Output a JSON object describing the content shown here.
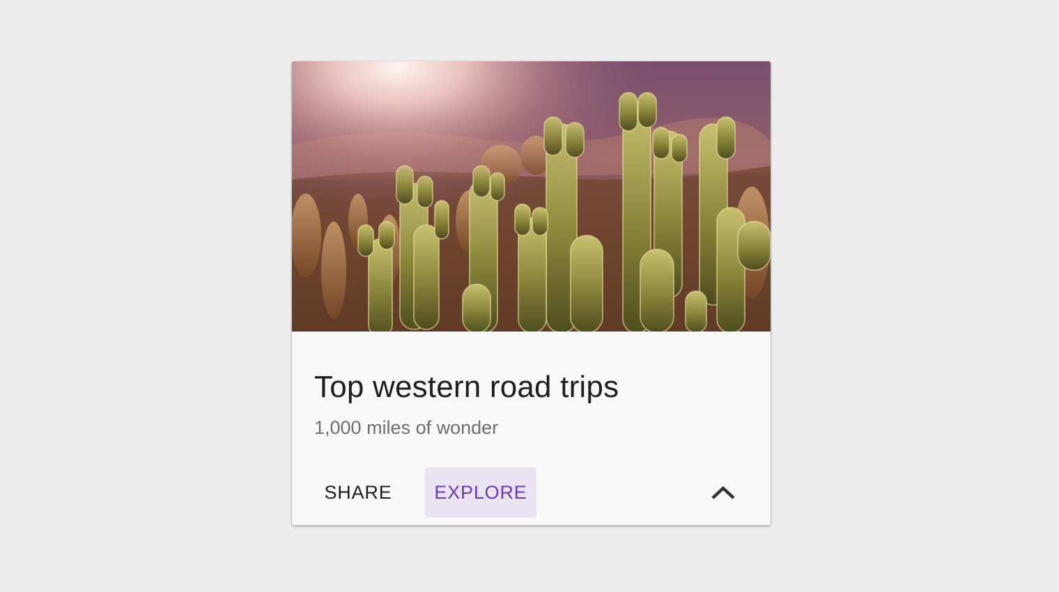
{
  "card": {
    "image_alt": "Backlit cholla cacti in a desert at sunset",
    "title": "Top western road trips",
    "subtitle": "1,000 miles of wonder",
    "actions": {
      "share_label": "SHARE",
      "explore_label": "EXPLORE",
      "expand_icon": "chevron-up-icon"
    }
  },
  "colors": {
    "page_background": "#ededed",
    "card_surface": "#f8f8f8",
    "primary": "#6a3ab2",
    "primary_container": "#e9e3f2",
    "on_surface": "#1e1e1e",
    "on_surface_variant": "#6f6f6f"
  }
}
